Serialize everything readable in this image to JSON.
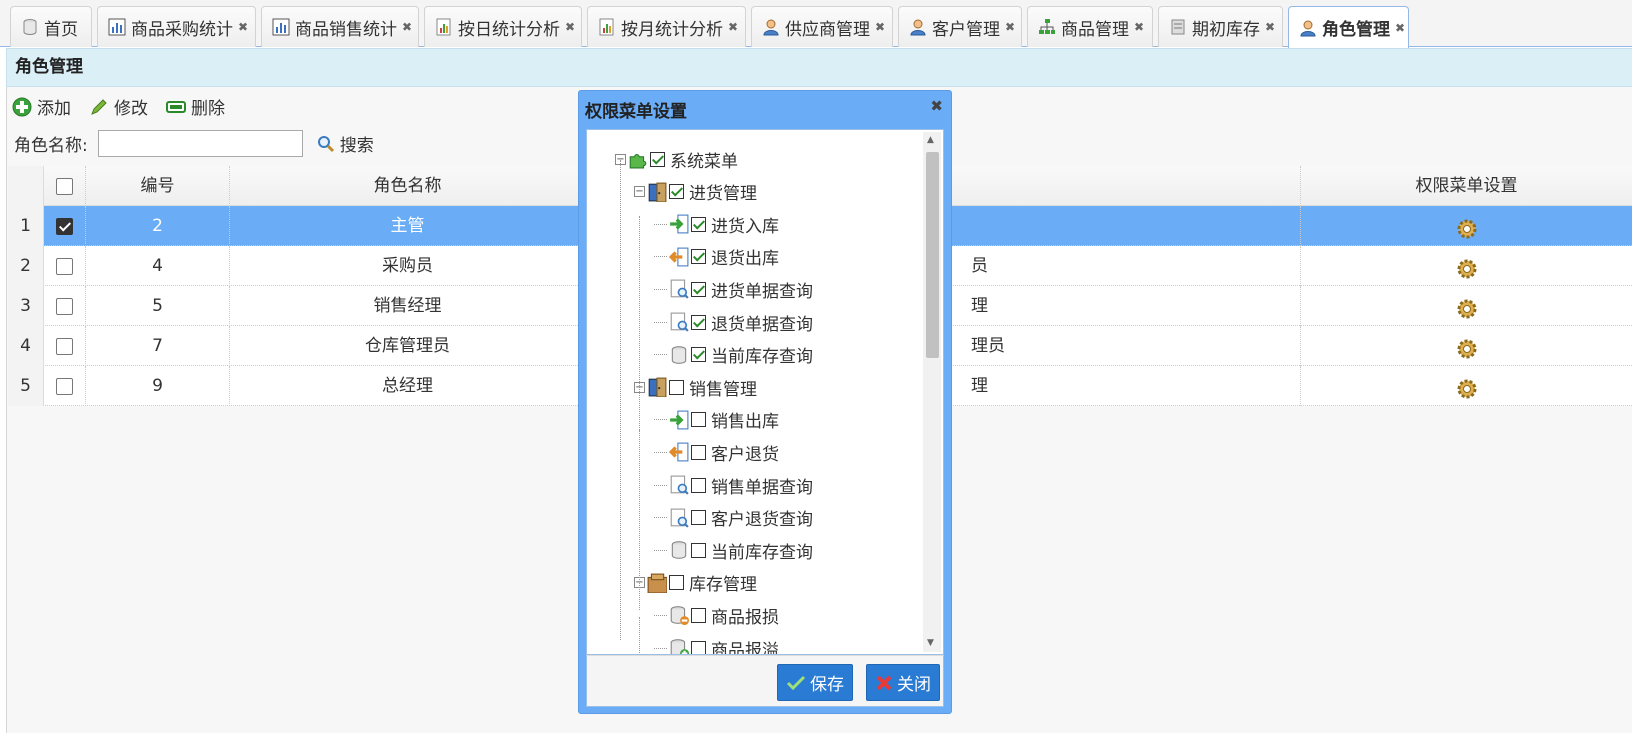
{
  "tabs": [
    {
      "label": "首页",
      "icon": "database-icon",
      "closable": false
    },
    {
      "label": "商品采购统计",
      "icon": "bar-chart-icon",
      "closable": true
    },
    {
      "label": "商品销售统计",
      "icon": "bar-chart-icon",
      "closable": true
    },
    {
      "label": "按日统计分析",
      "icon": "report-chart-icon",
      "closable": true
    },
    {
      "label": "按月统计分析",
      "icon": "report-chart-icon",
      "closable": true
    },
    {
      "label": "供应商管理",
      "icon": "user-icon",
      "closable": true
    },
    {
      "label": "客户管理",
      "icon": "user-icon",
      "closable": true
    },
    {
      "label": "商品管理",
      "icon": "sitemap-icon",
      "closable": true
    },
    {
      "label": "期初库存",
      "icon": "stack-icon",
      "closable": true
    },
    {
      "label": "角色管理",
      "icon": "user-icon",
      "closable": true,
      "active": true
    }
  ],
  "tab_close_glyph": "✖",
  "panel": {
    "title": "角色管理"
  },
  "toolbar": {
    "add": "添加",
    "edit": "修改",
    "delete": "删除"
  },
  "search": {
    "label": "角色名称:",
    "value": "",
    "button": "搜索"
  },
  "grid": {
    "columns": {
      "id": "编号",
      "name": "角色名称",
      "menu": "权限菜单设置"
    },
    "rows": [
      {
        "num": "1",
        "checked": true,
        "id": "2",
        "name": "主管",
        "remark": "",
        "selected": true
      },
      {
        "num": "2",
        "checked": false,
        "id": "4",
        "name": "采购员",
        "remark": "员"
      },
      {
        "num": "3",
        "checked": false,
        "id": "5",
        "name": "销售经理",
        "remark": "理"
      },
      {
        "num": "4",
        "checked": false,
        "id": "7",
        "name": "仓库管理员",
        "remark": "理员"
      },
      {
        "num": "5",
        "checked": false,
        "id": "9",
        "name": "总经理",
        "remark": "理"
      }
    ]
  },
  "dialog": {
    "title": "权限菜单设置",
    "close_glyph": "✖",
    "save": "保存",
    "close": "关闭",
    "tree": [
      {
        "label": "系统菜单",
        "level": 0,
        "checked": true,
        "expandable": true,
        "icon": "puzzle-icon"
      },
      {
        "label": "进货管理",
        "level": 1,
        "checked": true,
        "expandable": true,
        "icon": "door-icon"
      },
      {
        "label": "进货入库",
        "level": 2,
        "checked": true,
        "icon": "arrow-in-icon"
      },
      {
        "label": "退货出库",
        "level": 2,
        "checked": true,
        "icon": "arrow-out-icon"
      },
      {
        "label": "进货单据查询",
        "level": 2,
        "checked": true,
        "icon": "doc-search-icon"
      },
      {
        "label": "退货单据查询",
        "level": 2,
        "checked": true,
        "icon": "doc-search-icon"
      },
      {
        "label": "当前库存查询",
        "level": 2,
        "checked": true,
        "icon": "database-icon"
      },
      {
        "label": "销售管理",
        "level": 1,
        "checked": false,
        "expandable": true,
        "icon": "door-icon"
      },
      {
        "label": "销售出库",
        "level": 2,
        "checked": false,
        "icon": "arrow-in-icon"
      },
      {
        "label": "客户退货",
        "level": 2,
        "checked": false,
        "icon": "arrow-out-icon"
      },
      {
        "label": "销售单据查询",
        "level": 2,
        "checked": false,
        "icon": "doc-search-icon"
      },
      {
        "label": "客户退货查询",
        "level": 2,
        "checked": false,
        "icon": "doc-search-icon"
      },
      {
        "label": "当前库存查询",
        "level": 2,
        "checked": false,
        "icon": "database-icon"
      },
      {
        "label": "库存管理",
        "level": 1,
        "checked": false,
        "expandable": true,
        "icon": "box-icon"
      },
      {
        "label": "商品报损",
        "level": 2,
        "checked": false,
        "icon": "database-minus-icon"
      },
      {
        "label": "商品报溢",
        "level": 2,
        "checked": false,
        "icon": "database-plus-icon"
      }
    ]
  },
  "colors": {
    "accent": "#6aacf6",
    "header": "#dbeff7",
    "button": "#2a7bd3"
  }
}
